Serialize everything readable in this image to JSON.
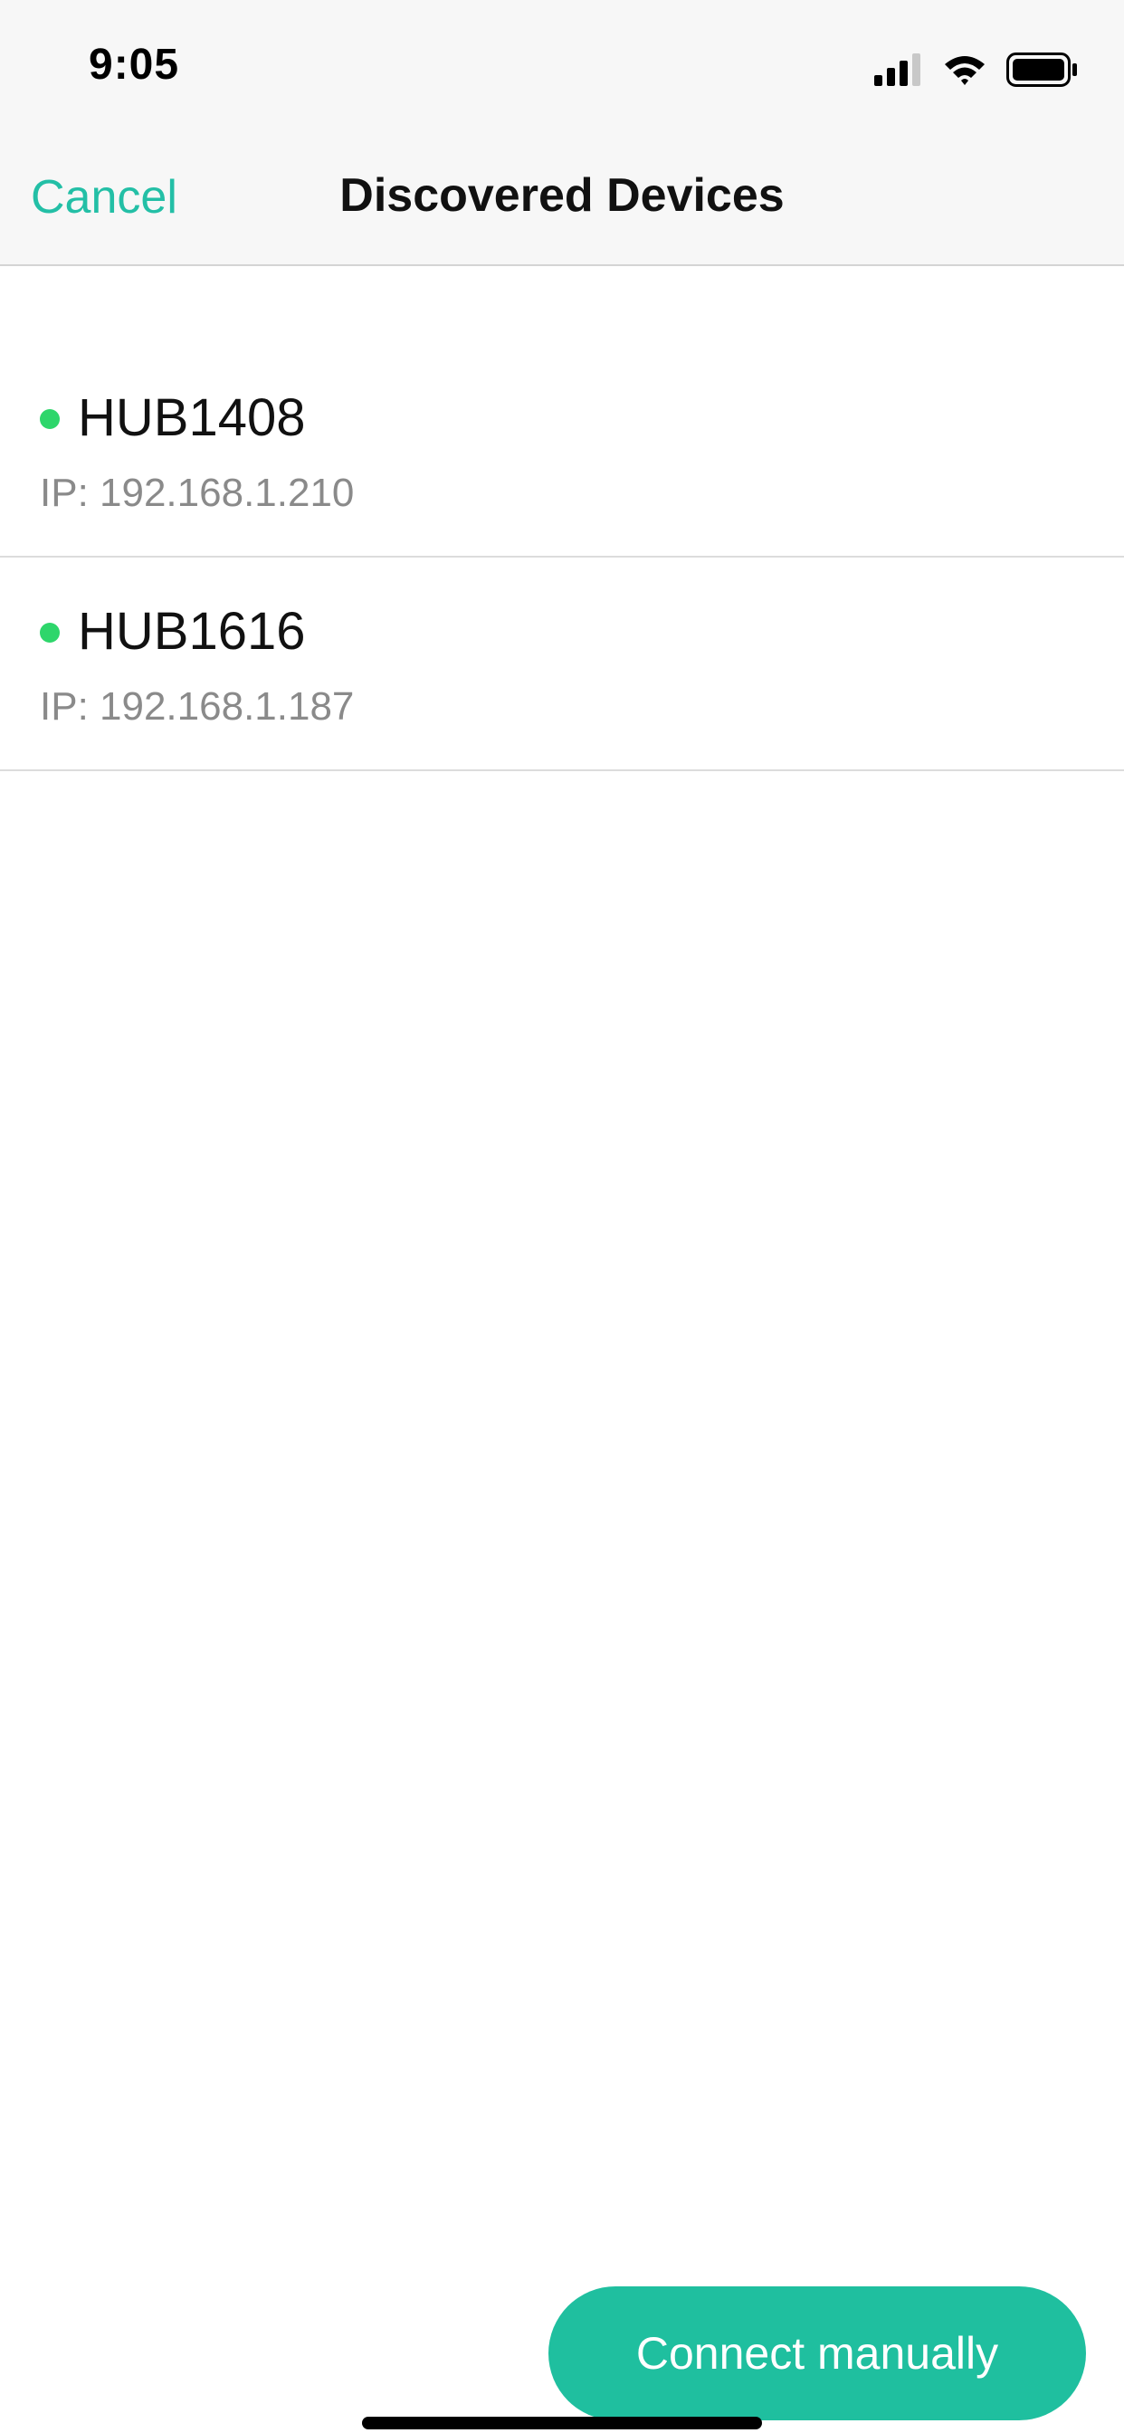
{
  "status_bar": {
    "time": "9:05",
    "icons": [
      "signal-icon",
      "wifi-icon",
      "battery-icon"
    ]
  },
  "nav": {
    "cancel_label": "Cancel",
    "title": "Discovered Devices"
  },
  "devices": [
    {
      "name": "HUB1408",
      "ip": "IP: 192.168.1.210",
      "status": "online"
    },
    {
      "name": "HUB1616",
      "ip": "IP: 192.168.1.187",
      "status": "online"
    }
  ],
  "connect_button": {
    "label": "Connect manually"
  },
  "colors": {
    "accent": "#23bfa6",
    "button_bg": "#1fbf9f",
    "online_dot": "#2ed66b",
    "nav_bg": "#f7f7f7",
    "secondary_text": "#8a8a8a"
  }
}
